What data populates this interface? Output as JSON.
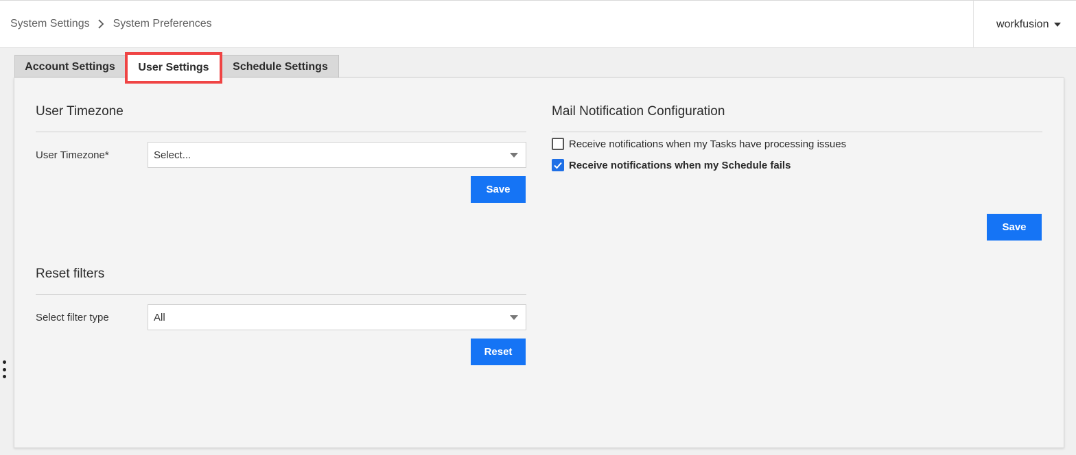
{
  "header": {
    "breadcrumb": [
      "System Settings",
      "System Preferences"
    ],
    "user_menu_label": "workfusion"
  },
  "tabs": [
    {
      "label": "Account Settings",
      "active": false
    },
    {
      "label": "User Settings",
      "active": true
    },
    {
      "label": "Schedule Settings",
      "active": false
    }
  ],
  "user_timezone": {
    "title": "User Timezone",
    "field_label": "User Timezone*",
    "select_value": "Select...",
    "save_label": "Save"
  },
  "reset_filters": {
    "title": "Reset filters",
    "field_label": "Select filter type",
    "select_value": "All",
    "reset_label": "Reset"
  },
  "mail_notifications": {
    "title": "Mail Notification Configuration",
    "options": [
      {
        "label": "Receive notifications when my Tasks have processing issues",
        "checked": false
      },
      {
        "label": "Receive notifications when my Schedule fails",
        "checked": true
      }
    ],
    "save_label": "Save"
  },
  "colors": {
    "primary_button": "#1574f5",
    "active_tab_highlight": "#ef4444",
    "checkbox_checked": "#1e6fe6"
  },
  "icons": {
    "breadcrumb_separator": "chevron-right-icon",
    "user_menu": "caret-down-icon",
    "select_dropdown": "caret-down-icon",
    "checkbox_checked": "checkmark-icon",
    "side_handle": "kebab-icon"
  }
}
